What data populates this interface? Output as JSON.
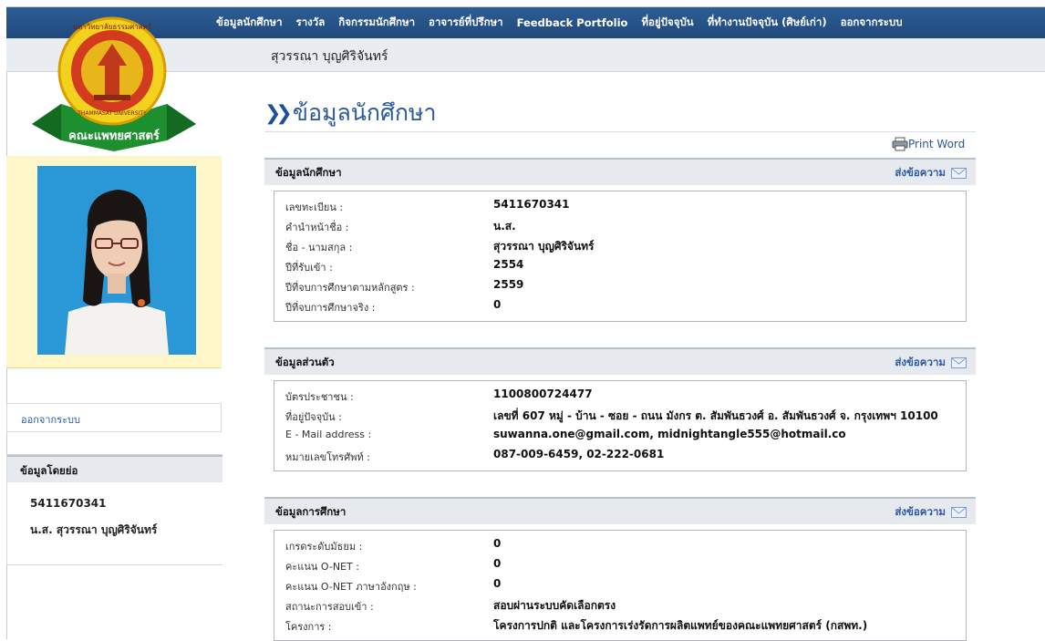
{
  "nav": [
    "ข้อมูลนักศึกษา",
    "รางวัล",
    "กิจกรรมนักศึกษา",
    "อาจารย์ที่ปรึกษา",
    "Feedback Portfolio",
    "ที่อยู่ปัจจุบัน",
    "ที่ทำงานปัจจุบัน (ศิษย์เก่า)",
    "ออกจากระบบ"
  ],
  "student_name": "สุวรรณา บุญศิริจันทร์",
  "page_title": "ข้อมูลนักศึกษา",
  "print_word": "Print Word",
  "logo": {
    "top_text": "มหาวิทยาลัยธรรมศาสตร์",
    "uni_text": "THAMMASAT UNIVERSITY",
    "ribbon_text": "คณะแพทยศาสตร์"
  },
  "sidebar": {
    "logout": "ออกจากระบบ",
    "brief_title": "ข้อมูลโดยย่อ",
    "brief_id": "5411670341",
    "brief_name": "น.ส. สุวรรณา บุญศิริจันทร์"
  },
  "send_message": "ส่งข้อความ",
  "sections": [
    {
      "title": "ข้อมูลนักศึกษา",
      "rows": [
        {
          "k": "เลขทะเบียน :",
          "v": "5411670341"
        },
        {
          "k": "คำนำหน้าชื่อ :",
          "v": "น.ส."
        },
        {
          "k": "ชื่อ - นามสกุล  :",
          "v": "สุวรรณา บุญศิริจันทร์"
        },
        {
          "k": "ปีที่รับเข้า :",
          "v": "2554"
        },
        {
          "k": "ปีที่จบการศึกษาตามหลักสูตร :",
          "v": "2559"
        },
        {
          "k": "ปีที่จบการศึกษาจริง :",
          "v": "0"
        }
      ]
    },
    {
      "title": "ข้อมูลส่วนตัว",
      "rows": [
        {
          "k": "บัตรประชาชน :",
          "v": "1100800724477"
        },
        {
          "k": "ที่อยู่ปัจจุบัน :",
          "v": "เลขที่ 607 หมู่ - บ้าน - ซอย - ถนน มังกร ต. สัมพันธวงศ์ อ. สัมพันธวงศ์ จ. กรุงเทพฯ 10100"
        },
        {
          "k": "E - Mail address :",
          "v": "suwanna.one@gmail.com, midnightangle555@hotmail.co"
        },
        {
          "k": "หมายเลขโทรศัพท์ :",
          "v": "087-009-6459, 02-222-0681"
        }
      ]
    },
    {
      "title": "ข้อมูลการศึกษา",
      "rows": [
        {
          "k": "เกรดระดับมัธยม :",
          "v": "0"
        },
        {
          "k": "คะแนน O-NET :",
          "v": "0"
        },
        {
          "k": "คะแนน O-NET ภาษาอังกฤษ :",
          "v": "0"
        },
        {
          "k": "สถานะการสอบเข้า :",
          "v": " สอบผ่านระบบคัดเลือกตรง"
        },
        {
          "k": "โครงการ  :",
          "v": "โครงการปกติ และโครงการเร่งรัดการผลิตแพทย์ของคณะแพทยศาสตร์ (กสพท.)"
        }
      ]
    }
  ]
}
